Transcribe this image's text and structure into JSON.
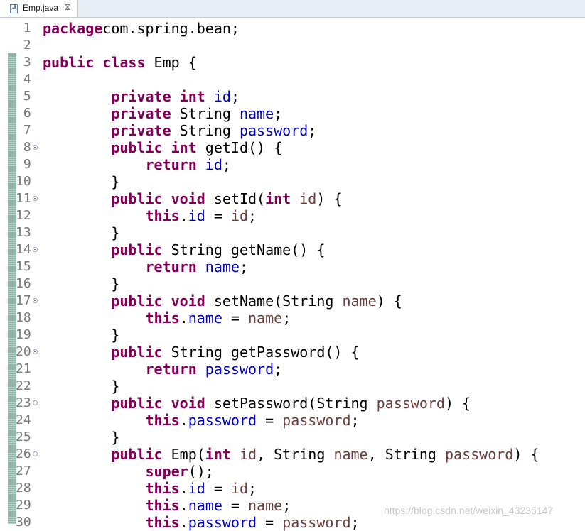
{
  "tab": {
    "label": "Emp.java",
    "close_glyph": "⊠",
    "icon": "java-file-icon"
  },
  "code_lines": [
    {
      "n": "1",
      "fold": false,
      "tokens": [
        [
          "kw",
          "package"
        ],
        [
          "",
          "com.spring.bean;"
        ]
      ]
    },
    {
      "n": "2",
      "fold": false,
      "tokens": []
    },
    {
      "n": "3",
      "fold": false,
      "tokens": [
        [
          "kw",
          "public"
        ],
        [
          "",
          " "
        ],
        [
          "kw",
          "class"
        ],
        [
          "",
          " Emp {"
        ]
      ]
    },
    {
      "n": "4",
      "fold": false,
      "tokens": []
    },
    {
      "n": "5",
      "fold": false,
      "tokens": [
        [
          "",
          "        "
        ],
        [
          "kw",
          "private"
        ],
        [
          "",
          " "
        ],
        [
          "kw",
          "int"
        ],
        [
          "",
          " "
        ],
        [
          "fld",
          "id"
        ],
        [
          "",
          ";"
        ]
      ]
    },
    {
      "n": "6",
      "fold": false,
      "tokens": [
        [
          "",
          "        "
        ],
        [
          "kw",
          "private"
        ],
        [
          "",
          " String "
        ],
        [
          "fld",
          "name"
        ],
        [
          "",
          ";"
        ]
      ]
    },
    {
      "n": "7",
      "fold": false,
      "tokens": [
        [
          "",
          "        "
        ],
        [
          "kw",
          "private"
        ],
        [
          "",
          " String "
        ],
        [
          "fld",
          "password"
        ],
        [
          "",
          ";"
        ]
      ]
    },
    {
      "n": "8",
      "fold": true,
      "tokens": [
        [
          "",
          "        "
        ],
        [
          "kw",
          "public"
        ],
        [
          "",
          " "
        ],
        [
          "kw",
          "int"
        ],
        [
          "",
          " getId() {"
        ]
      ]
    },
    {
      "n": "9",
      "fold": false,
      "tokens": [
        [
          "",
          "            "
        ],
        [
          "kw",
          "return"
        ],
        [
          "",
          " "
        ],
        [
          "fld",
          "id"
        ],
        [
          "",
          ";"
        ]
      ]
    },
    {
      "n": "10",
      "fold": false,
      "tokens": [
        [
          "",
          "        }"
        ]
      ]
    },
    {
      "n": "11",
      "fold": true,
      "tokens": [
        [
          "",
          "        "
        ],
        [
          "kw",
          "public"
        ],
        [
          "",
          " "
        ],
        [
          "kw",
          "void"
        ],
        [
          "",
          " setId("
        ],
        [
          "kw",
          "int"
        ],
        [
          "",
          " "
        ],
        [
          "prm",
          "id"
        ],
        [
          "",
          ") {"
        ]
      ]
    },
    {
      "n": "12",
      "fold": false,
      "tokens": [
        [
          "",
          "            "
        ],
        [
          "kw",
          "this"
        ],
        [
          "",
          "."
        ],
        [
          "fld",
          "id"
        ],
        [
          "",
          " = "
        ],
        [
          "prm",
          "id"
        ],
        [
          "",
          ";"
        ]
      ]
    },
    {
      "n": "13",
      "fold": false,
      "tokens": [
        [
          "",
          "        }"
        ]
      ]
    },
    {
      "n": "14",
      "fold": true,
      "tokens": [
        [
          "",
          "        "
        ],
        [
          "kw",
          "public"
        ],
        [
          "",
          " String getName() {"
        ]
      ]
    },
    {
      "n": "15",
      "fold": false,
      "tokens": [
        [
          "",
          "            "
        ],
        [
          "kw",
          "return"
        ],
        [
          "",
          " "
        ],
        [
          "fld",
          "name"
        ],
        [
          "",
          ";"
        ]
      ]
    },
    {
      "n": "16",
      "fold": false,
      "tokens": [
        [
          "",
          "        }"
        ]
      ]
    },
    {
      "n": "17",
      "fold": true,
      "tokens": [
        [
          "",
          "        "
        ],
        [
          "kw",
          "public"
        ],
        [
          "",
          " "
        ],
        [
          "kw",
          "void"
        ],
        [
          "",
          " setName(String "
        ],
        [
          "prm",
          "name"
        ],
        [
          "",
          ") {"
        ]
      ]
    },
    {
      "n": "18",
      "fold": false,
      "tokens": [
        [
          "",
          "            "
        ],
        [
          "kw",
          "this"
        ],
        [
          "",
          "."
        ],
        [
          "fld",
          "name"
        ],
        [
          "",
          " = "
        ],
        [
          "prm",
          "name"
        ],
        [
          "",
          ";"
        ]
      ]
    },
    {
      "n": "19",
      "fold": false,
      "tokens": [
        [
          "",
          "        }"
        ]
      ]
    },
    {
      "n": "20",
      "fold": true,
      "tokens": [
        [
          "",
          "        "
        ],
        [
          "kw",
          "public"
        ],
        [
          "",
          " String getPassword() {"
        ]
      ]
    },
    {
      "n": "21",
      "fold": false,
      "tokens": [
        [
          "",
          "            "
        ],
        [
          "kw",
          "return"
        ],
        [
          "",
          " "
        ],
        [
          "fld",
          "password"
        ],
        [
          "",
          ";"
        ]
      ]
    },
    {
      "n": "22",
      "fold": false,
      "tokens": [
        [
          "",
          "        }"
        ]
      ]
    },
    {
      "n": "23",
      "fold": true,
      "tokens": [
        [
          "",
          "        "
        ],
        [
          "kw",
          "public"
        ],
        [
          "",
          " "
        ],
        [
          "kw",
          "void"
        ],
        [
          "",
          " setPassword(String "
        ],
        [
          "prm",
          "password"
        ],
        [
          "",
          ") {"
        ]
      ]
    },
    {
      "n": "24",
      "fold": false,
      "tokens": [
        [
          "",
          "            "
        ],
        [
          "kw",
          "this"
        ],
        [
          "",
          "."
        ],
        [
          "fld",
          "password"
        ],
        [
          "",
          " = "
        ],
        [
          "prm",
          "password"
        ],
        [
          "",
          ";"
        ]
      ]
    },
    {
      "n": "25",
      "fold": false,
      "tokens": [
        [
          "",
          "        }"
        ]
      ]
    },
    {
      "n": "26",
      "fold": true,
      "tokens": [
        [
          "",
          "        "
        ],
        [
          "kw",
          "public"
        ],
        [
          "",
          " Emp("
        ],
        [
          "kw",
          "int"
        ],
        [
          "",
          " "
        ],
        [
          "prm",
          "id"
        ],
        [
          "",
          ", String "
        ],
        [
          "prm",
          "name"
        ],
        [
          "",
          ", String "
        ],
        [
          "prm",
          "password"
        ],
        [
          "",
          ") {"
        ]
      ]
    },
    {
      "n": "27",
      "fold": false,
      "tokens": [
        [
          "",
          "            "
        ],
        [
          "kw",
          "super"
        ],
        [
          "",
          "();"
        ]
      ]
    },
    {
      "n": "28",
      "fold": false,
      "tokens": [
        [
          "",
          "            "
        ],
        [
          "kw",
          "this"
        ],
        [
          "",
          "."
        ],
        [
          "fld",
          "id"
        ],
        [
          "",
          " = "
        ],
        [
          "prm",
          "id"
        ],
        [
          "",
          ";"
        ]
      ]
    },
    {
      "n": "29",
      "fold": false,
      "tokens": [
        [
          "",
          "            "
        ],
        [
          "kw",
          "this"
        ],
        [
          "",
          "."
        ],
        [
          "fld",
          "name"
        ],
        [
          "",
          " = "
        ],
        [
          "prm",
          "name"
        ],
        [
          "",
          ";"
        ]
      ]
    },
    {
      "n": "30",
      "fold": false,
      "tokens": [
        [
          "",
          "            "
        ],
        [
          "kw",
          "this"
        ],
        [
          "",
          "."
        ],
        [
          "fld",
          "password"
        ],
        [
          "",
          " = "
        ],
        [
          "prm",
          "password"
        ],
        [
          "",
          ";"
        ]
      ]
    }
  ],
  "watermark": "https://blog.csdn.net/weixin_43235147",
  "colors": {
    "keyword": "#7f0055",
    "field": "#0000c0",
    "param": "#6a3e3e",
    "line_number": "#787878"
  }
}
